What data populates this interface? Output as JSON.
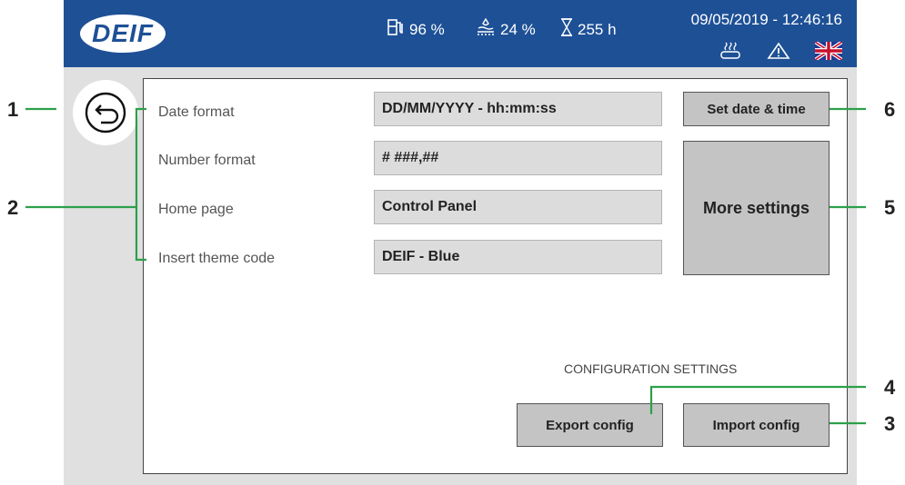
{
  "header": {
    "logo": "DEIF",
    "fuel_level": "96 %",
    "water_level": "24 %",
    "running_hours": "255 h",
    "datetime": "09/05/2019 - 12:46:16",
    "icons": [
      "fuel-pump-icon",
      "water-tank-icon",
      "hourglass-icon",
      "heater-icon",
      "warning-icon",
      "uk-flag-icon"
    ]
  },
  "settings": {
    "rows": [
      {
        "label": "Date format",
        "value": "DD/MM/YYYY - hh:mm:ss"
      },
      {
        "label": "Number format",
        "value": "# ###,##"
      },
      {
        "label": "Home page",
        "value": "Control Panel"
      },
      {
        "label": "Insert theme code",
        "value": "DEIF - Blue"
      }
    ],
    "set_date_time": "Set date & time",
    "more_settings": "More settings",
    "section_title": "CONFIGURATION SETTINGS",
    "export_config": "Export config",
    "import_config": "Import config"
  },
  "callouts": [
    "1",
    "2",
    "3",
    "4",
    "5",
    "6"
  ],
  "colors": {
    "brand": "#1e5096",
    "callout": "#2ca04a"
  }
}
